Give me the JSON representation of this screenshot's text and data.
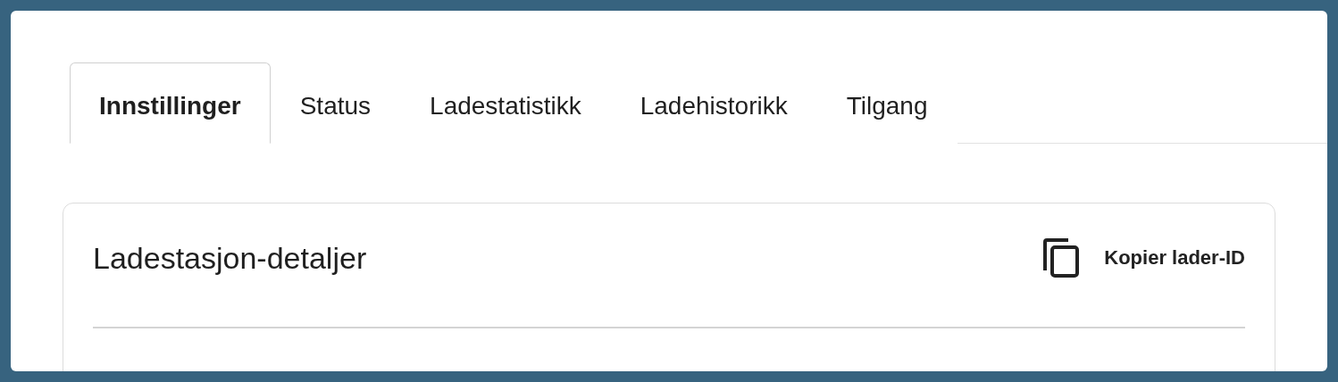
{
  "tabs": [
    {
      "label": "Innstillinger",
      "selected": true
    },
    {
      "label": "Status",
      "selected": false
    },
    {
      "label": "Ladestatistikk",
      "selected": false
    },
    {
      "label": "Ladehistorikk",
      "selected": false
    },
    {
      "label": "Tilgang",
      "selected": false
    }
  ],
  "card": {
    "title": "Ladestasjon-detaljer",
    "copy_button": "Kopier lader-ID"
  }
}
